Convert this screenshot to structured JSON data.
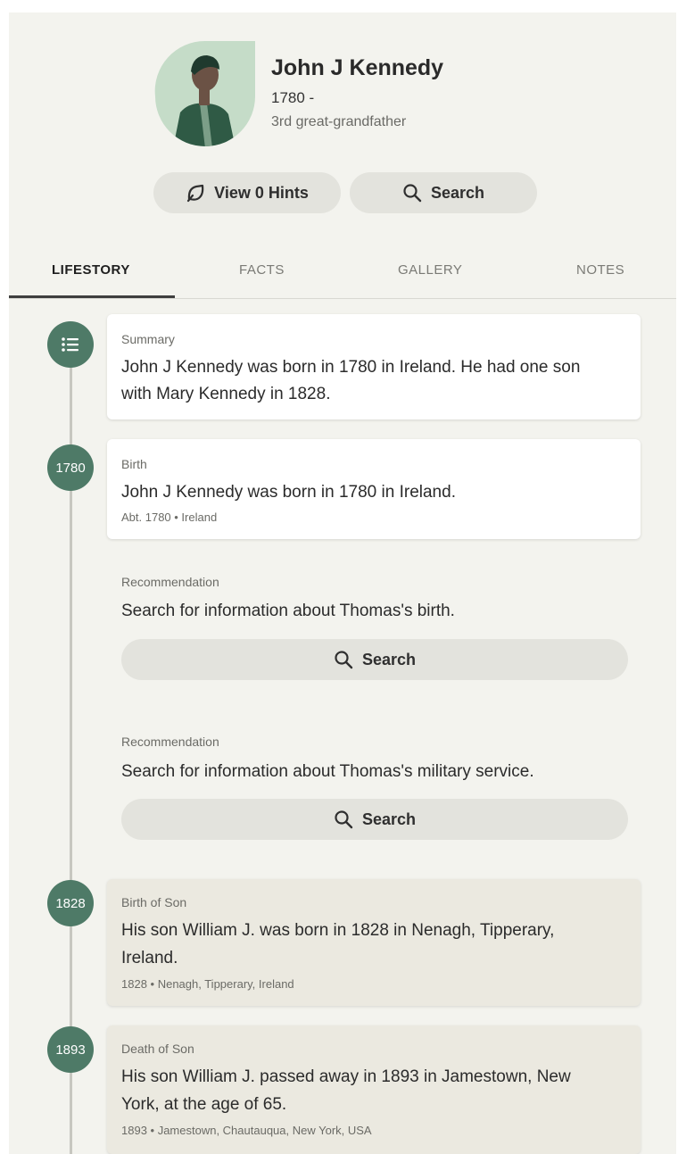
{
  "profile": {
    "name": "John J Kennedy",
    "lifespan": "1780 -",
    "relation": "3rd great-grandfather",
    "hints_label": "View 0 Hints",
    "search_label": "Search"
  },
  "tabs": [
    {
      "label": "LIFESTORY",
      "active": true
    },
    {
      "label": "FACTS",
      "active": false
    },
    {
      "label": "GALLERY",
      "active": false
    },
    {
      "label": "NOTES",
      "active": false
    }
  ],
  "timeline": {
    "summary": {
      "label": "Summary",
      "text_line1": "John J Kennedy was born in 1780 in Ireland. He had one son",
      "text_line2": "with Mary Kennedy in 1828."
    },
    "birth": {
      "year": "1780",
      "label": "Birth",
      "text": "John J Kennedy was born in 1780 in Ireland.",
      "meta": "Abt. 1780 • Ireland"
    },
    "recommendations": [
      {
        "label": "Recommendation",
        "text": "Search for information about Thomas's birth.",
        "button": "Search"
      },
      {
        "label": "Recommendation",
        "text": "Search for information about Thomas's military service.",
        "button": "Search"
      }
    ],
    "son_birth": {
      "year": "1828",
      "label": "Birth of Son",
      "text_line1": "His son William J. was born in 1828 in Nenagh, Tipperary,",
      "text_line2": "Ireland.",
      "meta": "1828 • Nenagh, Tipperary, Ireland"
    },
    "son_death": {
      "year": "1893",
      "label": "Death of Son",
      "text_line1": "His son William J. passed away in 1893 in Jamestown, New",
      "text_line2": "York, at the age of 65.",
      "meta": "1893 • Jamestown, Chautauqua, New York, USA"
    }
  },
  "colors": {
    "accent": "#4e7a67",
    "background": "#f3f3ee",
    "pill": "#e3e3dd",
    "tan_card": "#ebe9e0"
  }
}
